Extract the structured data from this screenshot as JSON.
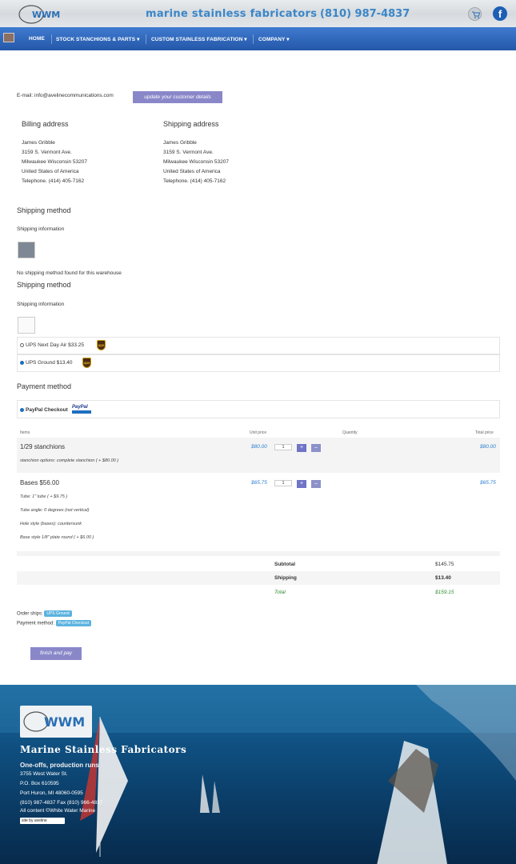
{
  "header": {
    "logo_text": "WWM",
    "tagline": "marine stainless fabricators",
    "phone": "(810) 987-4837"
  },
  "nav": {
    "items": [
      {
        "label": "HOME"
      },
      {
        "label": "STOCK STANCHIONS & PARTS ▾"
      },
      {
        "label": "CUSTOM STAINLESS FABRICATION ▾"
      },
      {
        "label": "COMPANY ▾"
      }
    ]
  },
  "customer": {
    "email_line": "E-mail: info@avelinecommunications.com",
    "update_button": "update your customer details"
  },
  "billing": {
    "heading": "Billing address",
    "lines": [
      "James Gribble",
      "3159 S. Vermont Ave.",
      "Milwaukee Wisconsin 53207",
      "United States of America",
      "Telephone. (414) 405-7162"
    ]
  },
  "shipping_address": {
    "heading": "Shipping address",
    "lines": [
      "James Gribble",
      "3159 S. Vermont Ave.",
      "Milwaukee Wisconsin 53207",
      "United States of America",
      "Telephone. (414) 405-7162"
    ]
  },
  "shipping_block_1": {
    "title": "Shipping method",
    "info_label": "Shipping information",
    "message": "No shipping method found for this warehouse"
  },
  "shipping_block_2": {
    "title": "Shipping method",
    "info_label": "Shipping information",
    "options": [
      {
        "label": "UPS Next Day Air $33.25",
        "selected": false
      },
      {
        "label": "UPS Ground $13.40",
        "selected": true
      }
    ]
  },
  "payment": {
    "title": "Payment method",
    "option": "PayPal Checkout",
    "logo_text": "PayPal"
  },
  "cart": {
    "headers": {
      "items": "Items",
      "unit_price": "Unit price",
      "quantity": "Quantity",
      "total_price": "Total price"
    },
    "items": [
      {
        "name": "1/29 stanchions",
        "unit_price": "$80.00",
        "quantity": "1",
        "total": "$80.00",
        "options": [
          "stanchion options: complete stanchion ( + $80.00 )"
        ]
      },
      {
        "name": "Bases $56.00",
        "unit_price": "$65.75",
        "quantity": "1",
        "total": "$65.75",
        "options": [
          "Tube: 1\" tube ( + $9.75 )",
          "Tube angle: 0 degrees (not vertical)",
          "Hole style (bases): countersunk",
          "Base style 1/8\" plate round ( + $6.00 )"
        ]
      }
    ]
  },
  "totals": {
    "subtotal_label": "Subtotal",
    "subtotal": "$145.75",
    "shipping_label": "Shipping",
    "shipping": "$13.40",
    "total_label": "Total",
    "total": "$159.15"
  },
  "summary": {
    "ships_label": "Order ships:",
    "ships_badge": "UPS Ground",
    "payment_label": "Payment method:",
    "payment_badge": "PayPal Checkout"
  },
  "finish_button": "finish and pay",
  "footer": {
    "title": "Marine Stainless Fabricators",
    "line1": "One-offs, production runs",
    "address1": "3755 West Water St.",
    "address2": "P.O. Box 610595",
    "address3": "Port Huron, MI 48060-0595",
    "phone": "(810) 987-4837 Fax (810) 966-4837",
    "copyright": "All content ©White Water Marine",
    "site_by": "site by aveline"
  },
  "colors": {
    "nav": "#2f6ac0",
    "accent_blue": "#3b86c8",
    "button": "#8a87c9",
    "green_total": "#2e8b2e"
  }
}
